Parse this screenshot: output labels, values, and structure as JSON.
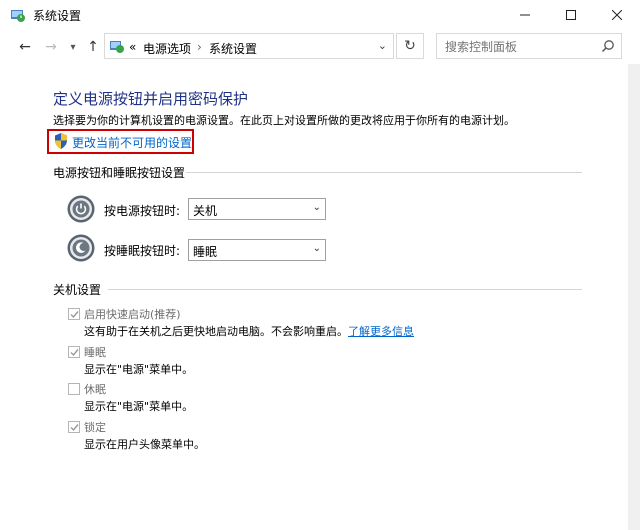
{
  "window": {
    "title": "系统设置",
    "icon": "power-options-icon",
    "controls": [
      "minimize-icon",
      "maximize-icon",
      "close-icon"
    ]
  },
  "toolbar": {
    "back": "←",
    "forward": "→",
    "up": "↑",
    "breadcrumb_prefix": "«",
    "crumb1": "电源选项",
    "separator": "›",
    "crumb2": "系统设置",
    "refresh": "↻",
    "search_placeholder": "搜索控制面板"
  },
  "content": {
    "heading": "定义电源按钮并启用密码保护",
    "description": "选择要为你的计算机设置的电源设置。在此页上对设置所做的更改将应用于你所有的电源计划。",
    "change_link": "更改当前不可用的设置",
    "power_section_title": "电源按钮和睡眠按钮设置",
    "power_button_label": "按电源按钮时:",
    "power_button_value": "关机",
    "sleep_button_label": "按睡眠按钮时:",
    "sleep_button_value": "睡眠",
    "shutdown_section_title": "关机设置",
    "options": [
      {
        "label": "启用快速启动(推荐)",
        "checked": true,
        "desc": "这有助于在关机之后更快地启动电脑。不会影响重启。",
        "link": "了解更多信息"
      },
      {
        "label": "睡眠",
        "checked": true,
        "desc": "显示在\"电源\"菜单中。"
      },
      {
        "label": "休眠",
        "checked": false,
        "desc": "显示在\"电源\"菜单中。"
      },
      {
        "label": "锁定",
        "checked": true,
        "desc": "显示在用户头像菜单中。"
      }
    ]
  },
  "colors": {
    "heading": "#1e3287",
    "link": "#0066cc",
    "highlight_box": "#cc0000"
  }
}
